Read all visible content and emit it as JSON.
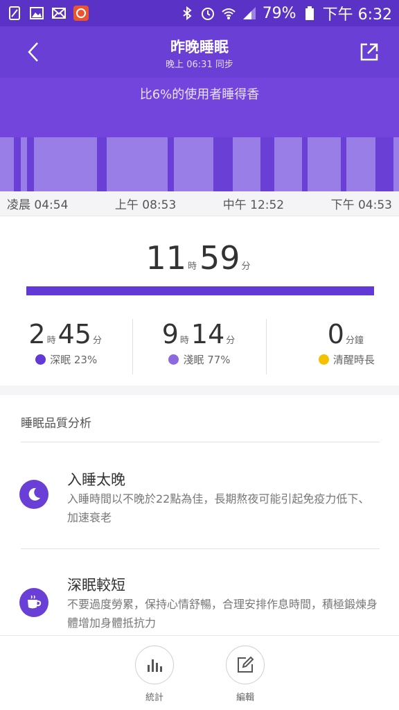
{
  "status_bar": {
    "battery": "79%",
    "time": "下午 6:32"
  },
  "header": {
    "title": "昨晚睡眠",
    "sync": "晚上 06:31 同步"
  },
  "banner": {
    "text": "比6%的使用者睡得香"
  },
  "timeline": [
    "凌晨 04:54",
    "上午 08:53",
    "中午 12:52",
    "下午 04:53"
  ],
  "total": {
    "hours": "11",
    "hours_unit": "時",
    "minutes": "59",
    "minutes_unit": "分"
  },
  "stats": [
    {
      "h": "2",
      "hu": "時",
      "m": "45",
      "mu": "分",
      "label": "深眠 23%",
      "color": "#6238d6"
    },
    {
      "h": "9",
      "hu": "時",
      "m": "14",
      "mu": "分",
      "label": "淺眠 77%",
      "color": "#8b6ae0"
    },
    {
      "m": "0",
      "mu": "分鐘",
      "label": "清醒時長",
      "color": "#f5c000"
    }
  ],
  "analysis": {
    "title": "睡眠品質分析",
    "items": [
      {
        "icon": "moon-icon",
        "title": "入睡太晚",
        "desc": "入睡時間以不晚於22點為佳，長期熬夜可能引起免疫力低下、加速衰老"
      },
      {
        "icon": "coffee-cup-icon",
        "title": "深眠較短",
        "desc": "不要過度勞累，保持心情舒暢，合理安排作息時間，積極鍛煉身體增加身體抵抗力"
      }
    ]
  },
  "bottom_nav": {
    "stats_label": "統計",
    "edit_label": "編輯"
  },
  "colors": {
    "header": "#6a3fd6",
    "deep": "#6238d6",
    "light": "#8b6ae0",
    "awake": "#f5c000"
  }
}
